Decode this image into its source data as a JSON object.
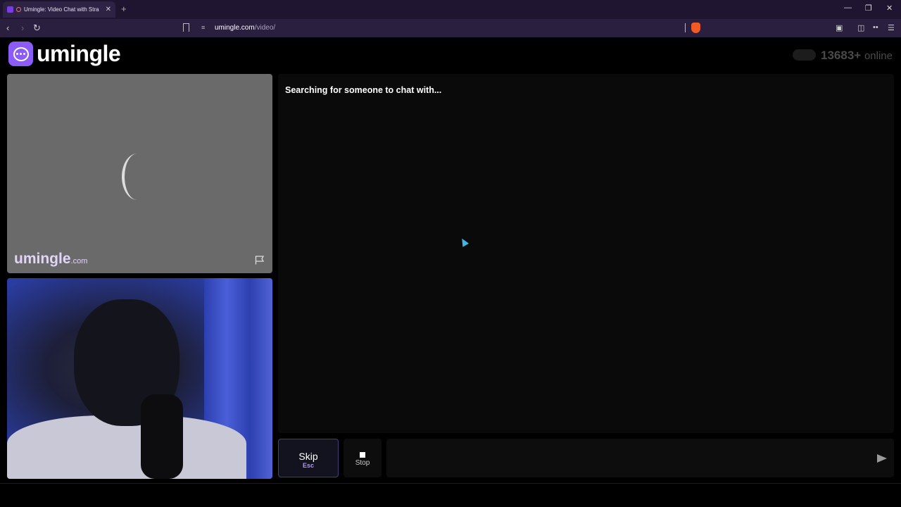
{
  "browser": {
    "tab_title": "Umingle: Video Chat with Stra",
    "tab_close": "✕",
    "new_tab": "+",
    "url_domain": "umingle.com",
    "url_path": "/video/",
    "minimize": "—",
    "restore": "❐",
    "close": "✕"
  },
  "site": {
    "logo": "umingle",
    "online_count": "13683+",
    "online_label": "online"
  },
  "stranger": {
    "watermark": "umingle",
    "watermark_suffix": ".com"
  },
  "chat": {
    "status": "Searching for someone to chat with..."
  },
  "controls": {
    "skip_label": "Skip",
    "skip_key": "Esc",
    "stop_label": "Stop",
    "message_placeholder": ""
  },
  "colors": {
    "brand": "#8b5cf6",
    "chrome": "#2a1f3f"
  }
}
